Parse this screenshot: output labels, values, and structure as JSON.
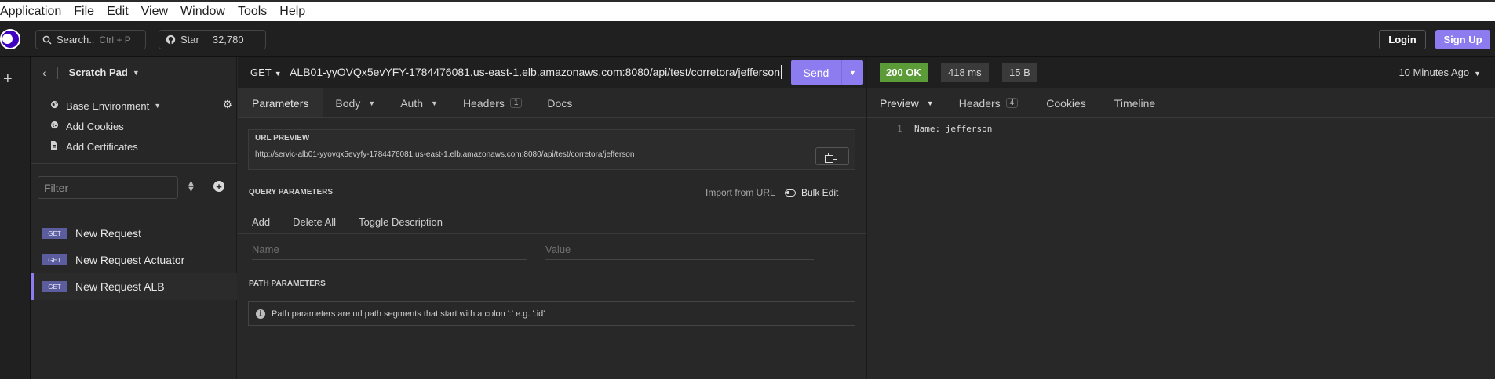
{
  "menu": [
    "Application",
    "File",
    "Edit",
    "View",
    "Window",
    "Tools",
    "Help"
  ],
  "header": {
    "search_label": "Search..",
    "search_shortcut": "Ctrl + P",
    "star_label": "Star",
    "star_count": "32,780",
    "login": "Login",
    "signup": "Sign Up"
  },
  "sidebar": {
    "title": "Scratch Pad",
    "environment": "Base Environment",
    "add_cookies": "Add Cookies",
    "add_certificates": "Add Certificates",
    "filter_placeholder": "Filter",
    "requests": [
      {
        "method": "GET",
        "name": "New Request"
      },
      {
        "method": "GET",
        "name": "New Request Actuator"
      },
      {
        "method": "GET",
        "name": "New Request ALB"
      }
    ]
  },
  "request": {
    "method": "GET",
    "url": "ALB01-yyOVQx5evYFY-1784476081.us-east-1.elb.amazonaws.com:8080/api/test/corretora/jefferson",
    "send": "Send",
    "tabs": [
      {
        "label": "Parameters"
      },
      {
        "label": "Body"
      },
      {
        "label": "Auth"
      },
      {
        "label": "Headers",
        "count": "1"
      },
      {
        "label": "Docs"
      }
    ],
    "url_preview_label": "URL PREVIEW",
    "url_preview": "http://servic-alb01-yyovqx5evyfy-1784476081.us-east-1.elb.amazonaws.com:8080/api/test/corretora/jefferson",
    "query_params_label": "QUERY PARAMETERS",
    "import_from_url": "Import from URL",
    "bulk_edit": "Bulk Edit",
    "actions": [
      "Add",
      "Delete All",
      "Toggle Description"
    ],
    "name_placeholder": "Name",
    "value_placeholder": "Value",
    "path_params_label": "PATH PARAMETERS",
    "path_params_info": "Path parameters are url path segments that start with a colon ':' e.g. ':id'"
  },
  "response": {
    "status": "200 OK",
    "time": "418 ms",
    "size": "15 B",
    "when": "10 Minutes Ago",
    "tabs": [
      {
        "label": "Preview"
      },
      {
        "label": "Headers",
        "count": "4"
      },
      {
        "label": "Cookies"
      },
      {
        "label": "Timeline"
      }
    ],
    "line_number": "1",
    "body": "Name: jefferson"
  },
  "colors": {
    "accent": "#8c7cf0",
    "status_ok": "#5c9c38",
    "method_badge": "#5c5d9e"
  }
}
